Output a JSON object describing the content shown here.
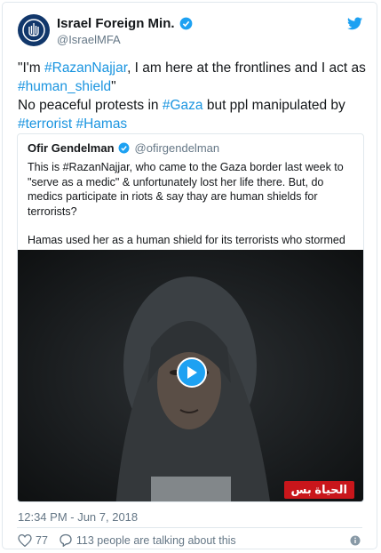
{
  "account": {
    "name": "Israel Foreign Min.",
    "handle": "@IsraelMFA"
  },
  "tweet": {
    "t1": "\"I'm ",
    "t1_tag": "#RazanNajjar",
    "t2": ", I am here at the frontlines and I act as",
    "t3_tag": "#human_shield",
    "t4": "\"",
    "t5": "No peaceful protests in ",
    "t5_tag": "#Gaza",
    "t6": " but ppl manipulated by",
    "t7_tag": "#terrorist",
    "t8": " ",
    "t8_tag": "#Hamas"
  },
  "quote": {
    "name": "Ofir Gendelman",
    "handle": "@ofirgendelman",
    "para1": "This is #RazanNajjar, who came to the Gaza border last week to \"serve as a medic\" & unfortunately lost her life there. But, do medics participate in riots & say thay are human shields for terrorists?",
    "para2": "Hamas used her as a human shield for its terrorists who stormed our border.",
    "media_logo": "الحياة بس"
  },
  "meta": {
    "timestamp": "12:34 PM - Jun 7, 2018",
    "likes": "77",
    "talking": "113 people are talking about this"
  },
  "colors": {
    "link": "#1b95e0",
    "verified": "#1da1f2",
    "avatar": "#11376b"
  },
  "icons": [
    "israel-emblem-icon",
    "verified-icon",
    "twitter-bird-icon",
    "play-icon",
    "heart-icon",
    "reply-icon",
    "info-icon"
  ]
}
